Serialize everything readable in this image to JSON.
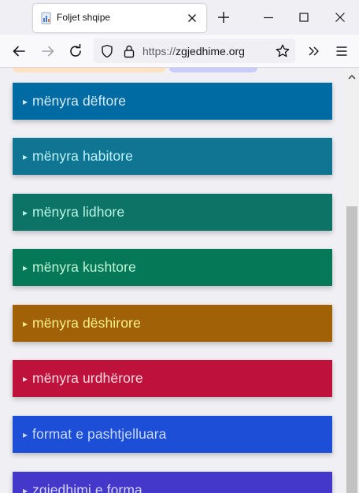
{
  "browser": {
    "tab_title": "Foljet shqipe",
    "url_protocol": "https://",
    "url_domain": "zgjedhime.org"
  },
  "sections": [
    {
      "arrow": "▸",
      "label": "mënyra dëftore",
      "bg": "#006aa3",
      "fg": "#d4ecfb"
    },
    {
      "arrow": "▸",
      "label": "mënyra habitore",
      "bg": "#0f7592",
      "fg": "#bdf2ff"
    },
    {
      "arrow": "▸",
      "label": "mënyra lidhore",
      "bg": "#0d7366",
      "fg": "#b7f8e6"
    },
    {
      "arrow": "▸",
      "label": "mënyra kushtore",
      "bg": "#047857",
      "fg": "#bff7d9"
    },
    {
      "arrow": "▸",
      "label": "mënyra dëshirore",
      "bg": "#a16207",
      "fg": "#fef08a"
    },
    {
      "arrow": "▸",
      "label": "mënyra urdhërore",
      "bg": "#be123c",
      "fg": "#ffd9e0"
    },
    {
      "arrow": "▸",
      "label": "format e pashtjelluara",
      "bg": "#1d4ed8",
      "fg": "#c9dbff"
    },
    {
      "arrow": "▸",
      "label": "zgjedhimi e forma",
      "bg": "#4338ca",
      "fg": "#d9d6ff"
    }
  ]
}
